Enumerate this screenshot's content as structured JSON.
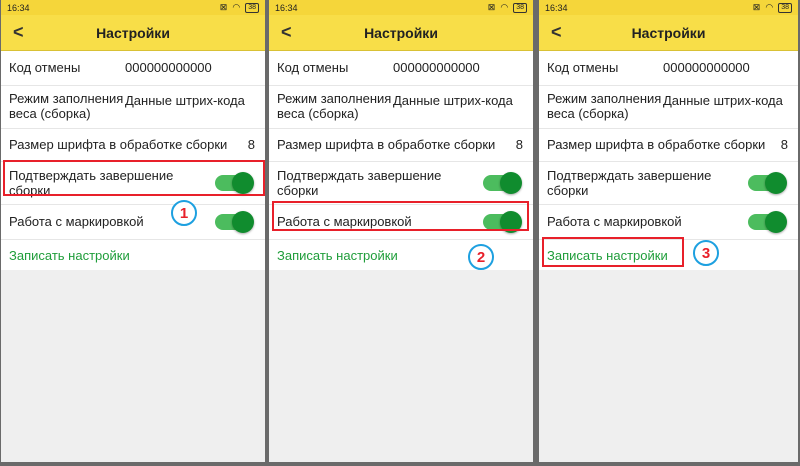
{
  "screens": [
    {
      "status": {
        "time": "16:34",
        "battery": "38"
      },
      "title": "Настройки",
      "rows": {
        "cancel_code_label": "Код отмены",
        "cancel_code_value": "000000000000",
        "weight_mode_label": "Режим заполнения веса (сборка)",
        "weight_mode_value": "Данные штрих-кода",
        "font_size_label": "Размер шрифта в обработке сборки",
        "font_size_value": "8",
        "confirm_label": "Подтверждать завершение сборки",
        "confirm_on": true,
        "marking_label": "Работа с маркировкой",
        "marking_on": true,
        "save_label": "Записать настройки"
      },
      "step": "1"
    },
    {
      "status": {
        "time": "16:34",
        "battery": "38"
      },
      "title": "Настройки",
      "rows": {
        "cancel_code_label": "Код отмены",
        "cancel_code_value": "000000000000",
        "weight_mode_label": "Режим заполнения веса (сборка)",
        "weight_mode_value": "Данные штрих-кода",
        "font_size_label": "Размер шрифта в обработке сборки",
        "font_size_value": "8",
        "confirm_label": "Подтверждать завершение сборки",
        "confirm_on": true,
        "marking_label": "Работа с маркировкой",
        "marking_on": true,
        "save_label": "Записать настройки"
      },
      "step": "2"
    },
    {
      "status": {
        "time": "16:34",
        "battery": "38"
      },
      "title": "Настройки",
      "rows": {
        "cancel_code_label": "Код отмены",
        "cancel_code_value": "000000000000",
        "weight_mode_label": "Режим заполнения веса (сборка)",
        "weight_mode_value": "Данные штрих-кода",
        "font_size_label": "Размер шрифта в обработке сборки",
        "font_size_value": "8",
        "confirm_label": "Подтверждать завершение сборки",
        "confirm_on": true,
        "marking_label": "Работа с маркировкой",
        "marking_on": true,
        "save_label": "Записать настройки"
      },
      "step": "3"
    }
  ],
  "colors": {
    "appbar": "#f8de48",
    "toggle_track": "#4cbc5e",
    "toggle_knob": "#108c2e",
    "highlight_frame": "#e8202a",
    "badge_ring": "#1da0e0",
    "save_link": "#1f9d3a"
  }
}
